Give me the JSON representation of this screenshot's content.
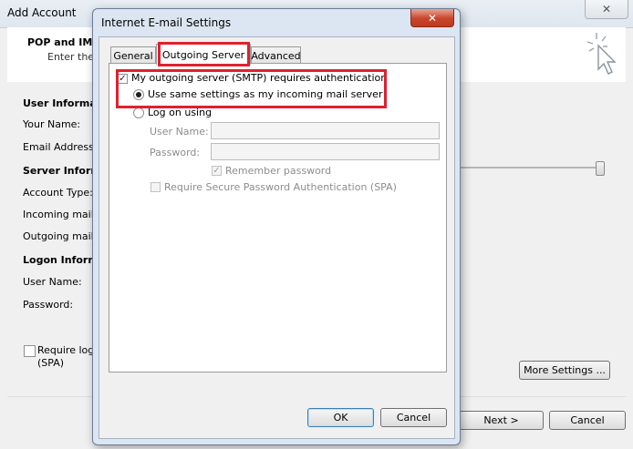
{
  "background_window": {
    "title": "Add Account",
    "close_glyph": "✕",
    "header": {
      "title": "POP and IMA",
      "subtitle": "Enter the r"
    },
    "labels": {
      "user_information": "User Informatio",
      "your_name": "Your Name:",
      "email_address": "Email Address:",
      "server_information": "Server Informa",
      "account_type": "Account Type:",
      "incoming_mail": "Incoming mail s",
      "outgoing_mail": "Outgoing mail",
      "logon_information": "Logon Informa",
      "user_name": "User Name:",
      "password": "Password:",
      "require_logon": "Require log",
      "spa": "(SPA)"
    },
    "buttons": {
      "more_settings": "More Settings ...",
      "next": "Next >",
      "cancel": "Cancel"
    }
  },
  "dialog": {
    "title": "Internet E-mail Settings",
    "close_glyph": "✕",
    "tabs": [
      {
        "label": "General",
        "active": false
      },
      {
        "label": "Outgoing Server",
        "active": true
      },
      {
        "label": "Advanced",
        "active": false
      }
    ],
    "outgoing": {
      "requires_auth_label": "My outgoing server (SMTP) requires authentication",
      "requires_auth_checked": true,
      "use_same_label": "Use same settings as my incoming mail server",
      "use_same_selected": true,
      "log_on_using_label": "Log on using",
      "log_on_using_selected": false,
      "user_name_label": "User Name:",
      "user_name_value": "",
      "password_label": "Password:",
      "password_value": "",
      "remember_password_label": "Remember password",
      "remember_password_checked": true,
      "spa_label": "Require Secure Password Authentication (SPA)",
      "spa_checked": false
    },
    "buttons": {
      "ok": "OK",
      "cancel": "Cancel"
    }
  },
  "colors": {
    "highlight": "#e0202f",
    "dialog_frame": "#dce6f2",
    "window_bg": "#f0f0f0"
  }
}
